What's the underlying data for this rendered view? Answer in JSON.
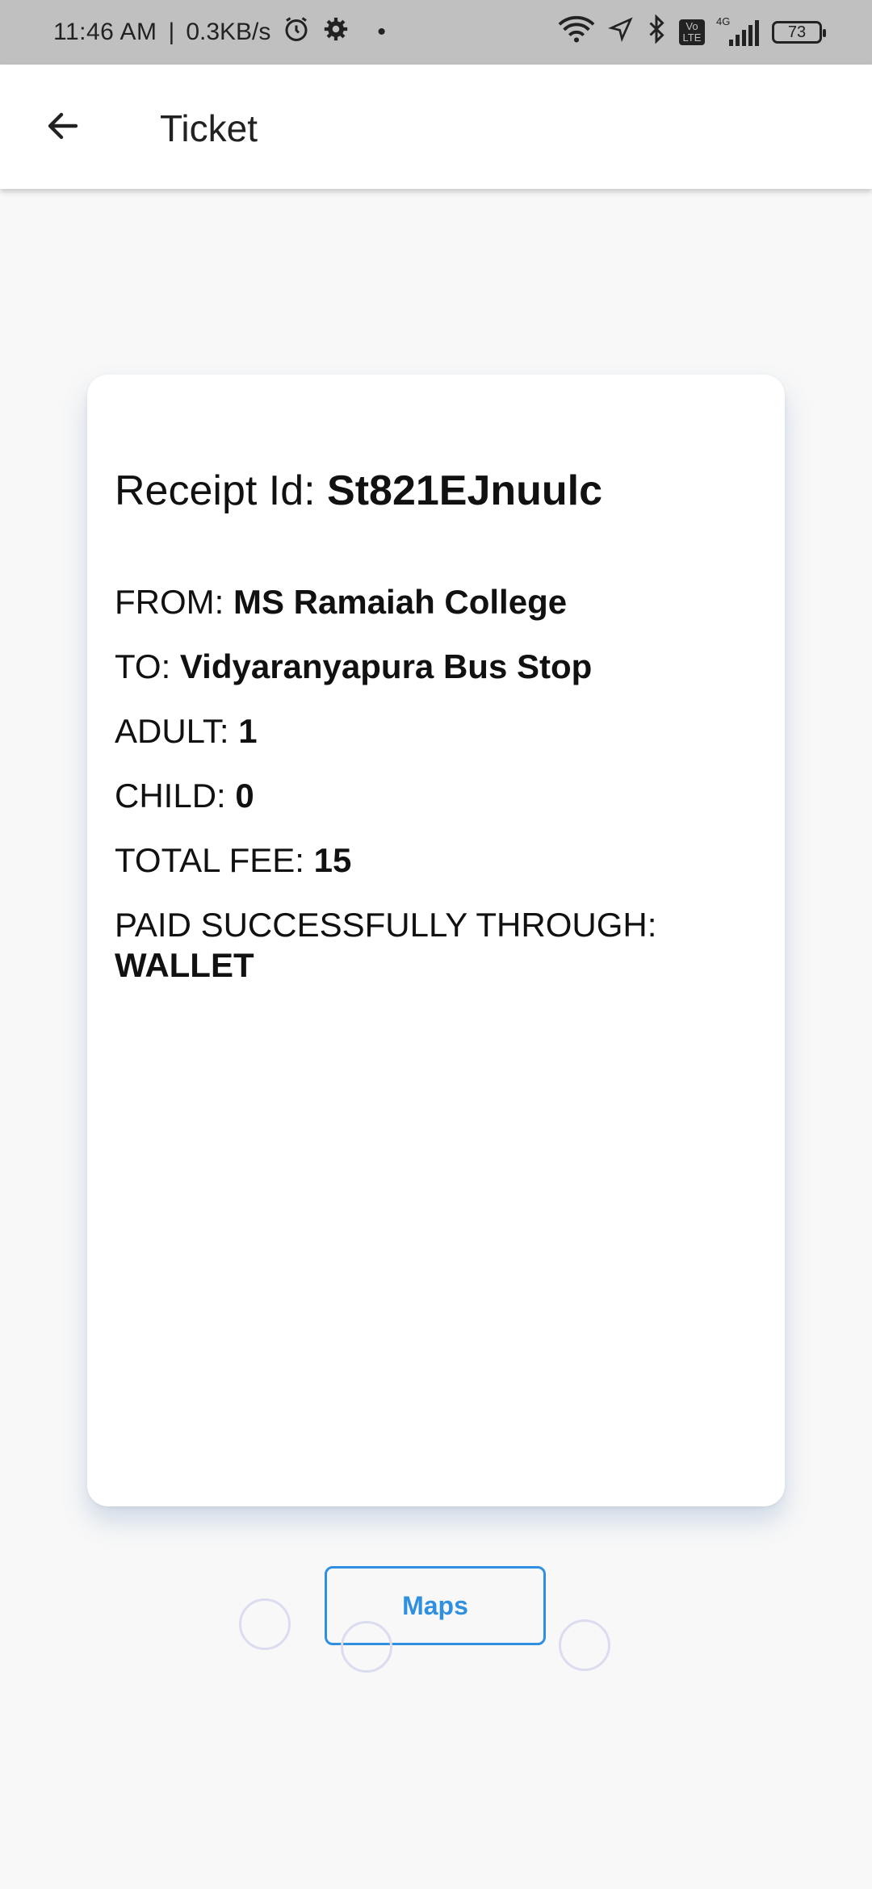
{
  "status_bar": {
    "time": "11:46 AM",
    "net_speed": "0.3KB/s",
    "network_label": "4G",
    "volte_label": "Vo LTE",
    "battery": "73"
  },
  "appbar": {
    "title": "Ticket"
  },
  "receipt": {
    "id_label": "Receipt Id:",
    "id_value": "St821EJnuulc"
  },
  "ticket": {
    "from_label": "FROM:",
    "from_value": "MS Ramaiah College",
    "to_label": "TO:",
    "to_value": "Vidyaranyapura Bus Stop",
    "adult_label": "ADULT:",
    "adult_value": "1",
    "child_label": "CHILD:",
    "child_value": "0",
    "fee_label": "TOTAL FEE:",
    "fee_value": "15",
    "paid_label": "PAID SUCCESSFULLY THROUGH:",
    "paid_value": "WALLET"
  },
  "actions": {
    "maps_label": "Maps"
  },
  "colors": {
    "accent": "#2f8fe0",
    "status_bar": "#c0c0c0",
    "background": "#f8f8f8"
  }
}
